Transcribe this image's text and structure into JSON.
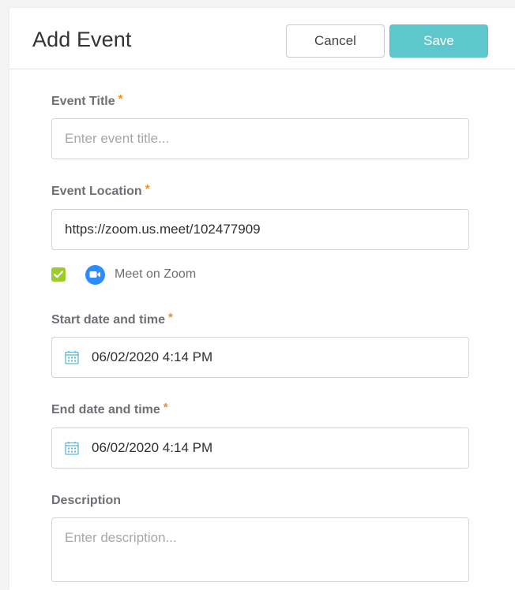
{
  "header": {
    "title": "Add Event",
    "cancel_label": "Cancel",
    "save_label": "Save"
  },
  "form": {
    "event_title": {
      "label": "Event Title",
      "required_mark": "*",
      "placeholder": "Enter event title...",
      "value": ""
    },
    "event_location": {
      "label": "Event Location",
      "required_mark": "*",
      "value": "https://zoom.us.meet/102477909"
    },
    "meet_on_zoom": {
      "checked": true,
      "label": "Meet on Zoom"
    },
    "start": {
      "label": "Start date and time",
      "required_mark": "*",
      "value": "06/02/2020 4:14 PM"
    },
    "end": {
      "label": "End date and time",
      "required_mark": "*",
      "value": "06/02/2020 4:14 PM"
    },
    "description": {
      "label": "Description",
      "placeholder": "Enter description...",
      "value": ""
    }
  },
  "icons": {
    "calendar": "calendar-icon",
    "zoom": "zoom-icon",
    "checkmark": "checkmark-icon"
  },
  "colors": {
    "save_button": "#5ec7cc",
    "required_asterisk": "#f08c1e",
    "checkbox": "#9ccc2c",
    "zoom_blue": "#2d8cff",
    "calendar_icon": "#5cb8d6"
  }
}
